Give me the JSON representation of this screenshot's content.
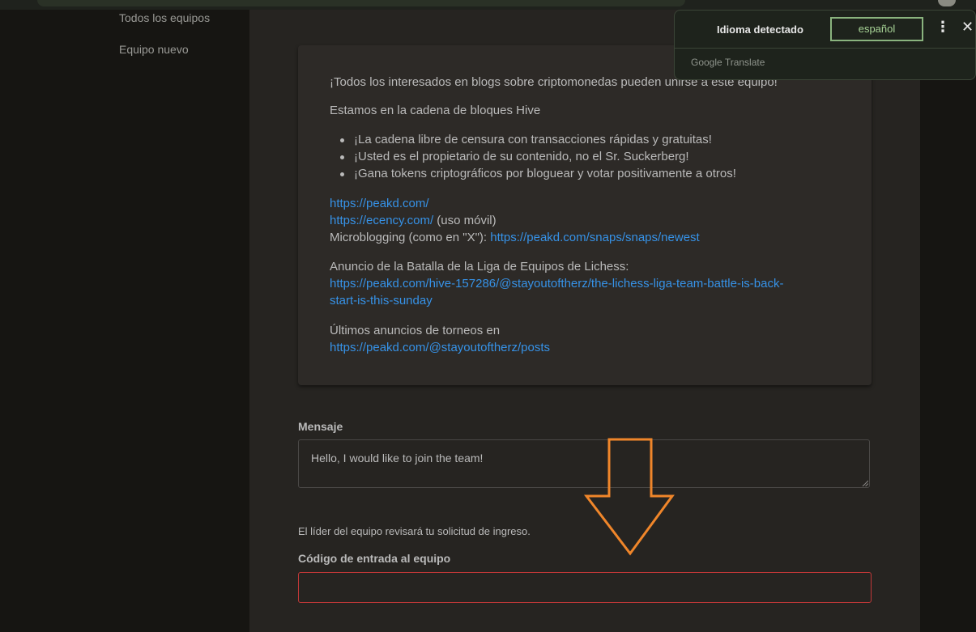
{
  "sidebar": {
    "items": [
      {
        "label": "Todos los equipos"
      },
      {
        "label": "Equipo nuevo"
      }
    ]
  },
  "description": {
    "intro": "¡Todos los interesados en blogs sobre criptomonedas pueden unirse a este equipo!",
    "chain": "Estamos en la cadena de bloques Hive",
    "bullets": [
      "¡La cadena libre de censura con transacciones rápidas y gratuitas!",
      "¡Usted es el propietario de su contenido, no el Sr. Suckerberg!",
      "¡Gana tokens criptográficos por bloguear y votar positivamente a otros!"
    ],
    "link_peakd": "https://peakd.com/",
    "link_ecency": "https://ecency.com/",
    "ecency_note": " (uso móvil)",
    "microblog_label": "Microblogging (como en \"X\"): ",
    "link_snaps": "https://peakd.com/snaps/snaps/newest",
    "battle_label": "Anuncio de la Batalla de la Liga de Equipos de Lichess:",
    "link_battle_1": "https://peakd.com/hive-157286/@stayoutoftherz/the-lichess-liga-team-battle-is-back-",
    "link_battle_2": "start-is-this-sunday",
    "tourney_label": "Últimos anuncios de torneos en",
    "link_posts": "https://peakd.com/@stayoutoftherz/posts"
  },
  "form": {
    "message_label": "Mensaje",
    "message_value": "Hello, I would like to join the team!",
    "hint": "El líder del equipo revisará tu solicitud de ingreso.",
    "code_label": "Código de entrada al equipo",
    "code_value": ""
  },
  "translate_popup": {
    "detected": "Idioma detectado",
    "language": "español",
    "brand": "Google Translate",
    "menu_icon": "more-vert-icon",
    "close_icon": "close-icon"
  },
  "colors": {
    "link": "#3692e7",
    "arrow": "#f0862a",
    "error_border": "#c23838",
    "translate_accent": "#8ab47e"
  }
}
